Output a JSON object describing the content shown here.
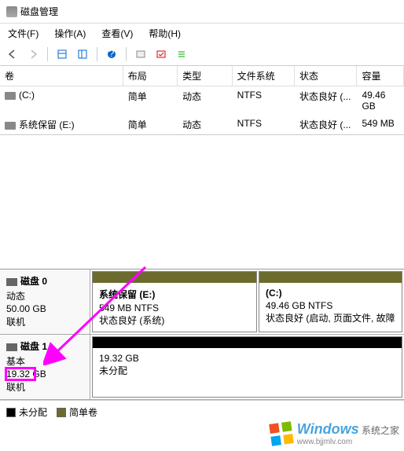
{
  "window": {
    "title": "磁盘管理"
  },
  "menu": {
    "file": "文件(F)",
    "action": "操作(A)",
    "view": "查看(V)",
    "help": "帮助(H)"
  },
  "columns": {
    "volume": "卷",
    "layout": "布局",
    "type": "类型",
    "fs": "文件系统",
    "status": "状态",
    "capacity": "容量"
  },
  "volumes": [
    {
      "name": "(C:)",
      "layout": "简单",
      "type": "动态",
      "fs": "NTFS",
      "status": "状态良好 (...",
      "capacity": "49.46 GB"
    },
    {
      "name": "系统保留 (E:)",
      "layout": "简单",
      "type": "动态",
      "fs": "NTFS",
      "status": "状态良好 (...",
      "capacity": "549 MB"
    }
  ],
  "disks": [
    {
      "name": "磁盘 0",
      "type": "动态",
      "size": "50.00 GB",
      "state": "联机",
      "partitions": [
        {
          "title": "系统保留  (E:)",
          "size": "549 MB NTFS",
          "status": "状态良好 (系统)",
          "header": "olive"
        },
        {
          "title": "(C:)",
          "size": "49.46 GB NTFS",
          "status": "状态良好 (启动, 页面文件, 故障",
          "header": "olive"
        }
      ]
    },
    {
      "name": "磁盘 1",
      "type": "基本",
      "size": "19.32 GB",
      "state": "联机",
      "partitions": [
        {
          "title": "",
          "size": "19.32 GB",
          "status": "未分配",
          "header": "black"
        }
      ]
    }
  ],
  "legend": {
    "unallocated": "未分配",
    "simple": "简单卷"
  },
  "watermark": {
    "brand": "Windows",
    "sub": "系统之家",
    "url": "www.bjjmlv.com"
  }
}
